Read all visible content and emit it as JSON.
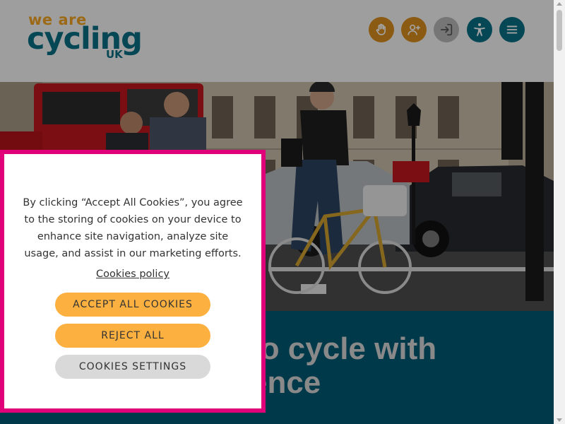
{
  "header": {
    "logo": {
      "line1": "we are",
      "line2": "cycling",
      "line3": "UK"
    },
    "buttons": [
      {
        "icon": "hand-icon",
        "color": "#d98f1e"
      },
      {
        "icon": "add-user-icon",
        "color": "#d98f1e"
      },
      {
        "icon": "login-icon",
        "color": "#b9b9b9"
      },
      {
        "icon": "accessibility-icon",
        "color": "#0a6f86"
      },
      {
        "icon": "menu-icon",
        "color": "#0a6f86"
      }
    ]
  },
  "hero": {
    "image": "cyclists-in-city-traffic-photo"
  },
  "banner": {
    "title": "Learn to cycle with confidence"
  },
  "cookie_banner": {
    "message": "By clicking “Accept All Cookies”, you agree to the storing of cookies on your device to enhance site navigation, analyze site usage, and assist in our marketing efforts.",
    "policy_link": "Cookies policy",
    "accept_label": "ACCEPT ALL COOKIES",
    "reject_label": "REJECT ALL",
    "settings_label": "COOKIES SETTINGS"
  },
  "colors": {
    "accent": "#fbb040",
    "brand": "#0a6f86",
    "border": "#e0007a",
    "banner": "#005a74"
  }
}
